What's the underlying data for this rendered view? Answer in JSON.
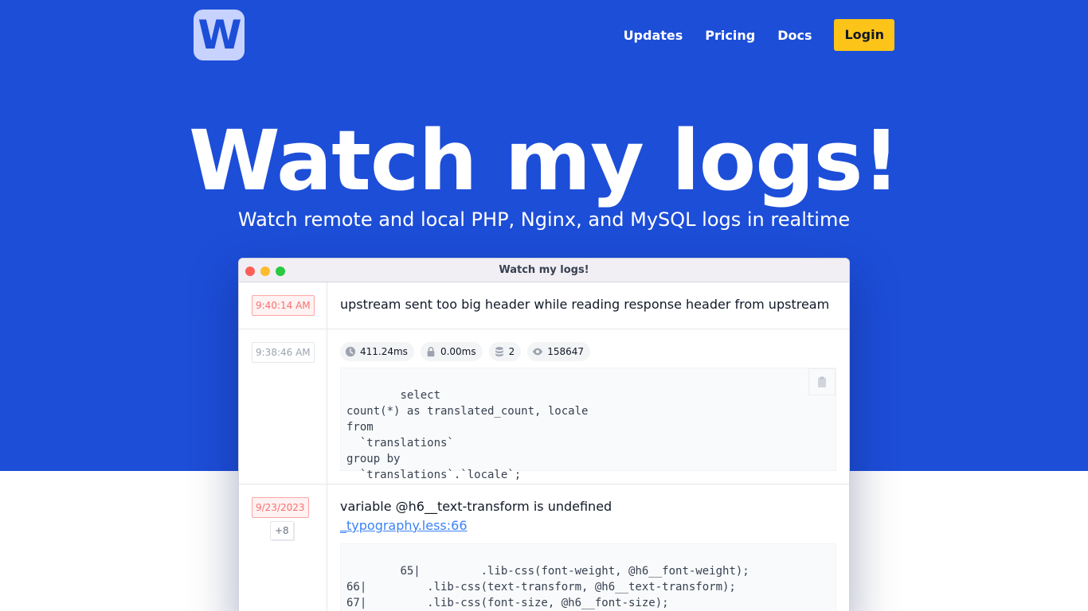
{
  "brand": {
    "logo_letter": "W"
  },
  "nav": {
    "items": [
      {
        "label": "Updates"
      },
      {
        "label": "Pricing"
      },
      {
        "label": "Docs"
      }
    ],
    "login_label": "Login"
  },
  "hero": {
    "title": "Watch my logs!",
    "subtitle": "Watch remote and local PHP, Nginx, and MySQL logs in realtime"
  },
  "window": {
    "title": "Watch my logs!",
    "entries": [
      {
        "time": "9:40:14 AM",
        "message": "upstream sent too big header while reading response header from upstream"
      },
      {
        "time": "9:38:46 AM",
        "badges": [
          {
            "icon": "clock-icon",
            "value": "411.24ms"
          },
          {
            "icon": "lock-icon",
            "value": "0.00ms"
          },
          {
            "icon": "database-icon",
            "value": "2"
          },
          {
            "icon": "eye-icon",
            "value": "158647"
          }
        ],
        "code": "select\ncount(*) as translated_count, locale\nfrom\n  `translations`\ngroup by\n  `translations`.`locale`;"
      },
      {
        "time": "9/23/2023",
        "more": "+8",
        "message": "variable @h6__text-transform is undefined",
        "file_link": "_typography.less:66",
        "code": "65|         .lib-css(font-weight, @h6__font-weight);\n66|         .lib-css(text-transform, @h6__text-transform);\n67|         .lib-css(font-size, @h6__font-size);"
      }
    ]
  }
}
